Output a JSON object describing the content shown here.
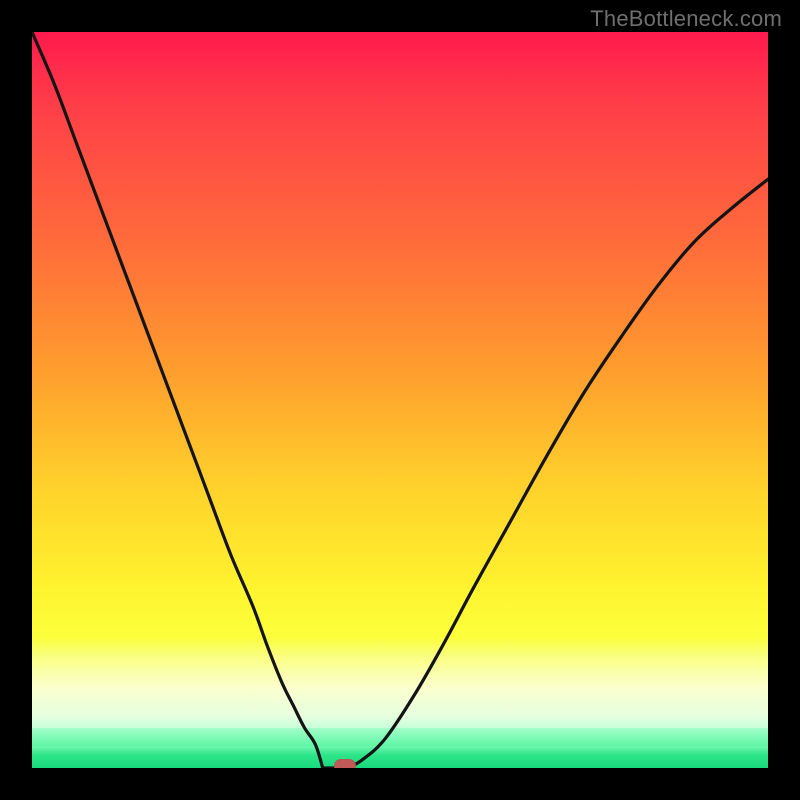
{
  "attribution": "TheBottleneck.com",
  "chart_data": {
    "type": "line",
    "title": "",
    "xlabel": "",
    "ylabel": "",
    "xlim": [
      0,
      1
    ],
    "ylim": [
      0,
      1
    ],
    "x": [
      0.0,
      0.03,
      0.06,
      0.09,
      0.12,
      0.15,
      0.18,
      0.21,
      0.24,
      0.27,
      0.3,
      0.32,
      0.34,
      0.355,
      0.37,
      0.385,
      0.4,
      0.41,
      0.417,
      0.423,
      0.43,
      0.45,
      0.48,
      0.52,
      0.56,
      0.6,
      0.65,
      0.7,
      0.75,
      0.8,
      0.85,
      0.9,
      0.95,
      1.0
    ],
    "y": [
      1.0,
      0.93,
      0.85,
      0.77,
      0.69,
      0.61,
      0.53,
      0.45,
      0.37,
      0.29,
      0.22,
      0.165,
      0.115,
      0.085,
      0.055,
      0.032,
      0.015,
      0.005,
      0.0,
      0.0,
      0.0,
      0.012,
      0.04,
      0.1,
      0.17,
      0.245,
      0.335,
      0.425,
      0.51,
      0.585,
      0.655,
      0.715,
      0.76,
      0.8
    ],
    "valley_flat": {
      "x_start": 0.395,
      "x_end": 0.43,
      "y": 0.0
    },
    "marker": {
      "x": 0.425,
      "y": 0.0,
      "color": "#c05a58"
    },
    "background": {
      "gradient_stops": [
        {
          "pos": 0.0,
          "color": "#ff1a4d"
        },
        {
          "pos": 0.45,
          "color": "#ff9a2e"
        },
        {
          "pos": 0.75,
          "color": "#fff22e"
        },
        {
          "pos": 0.94,
          "color": "#b4ffcf"
        },
        {
          "pos": 1.0,
          "color": "#18e080"
        }
      ],
      "green_strip_fraction": 0.03
    }
  },
  "style": {
    "curve_stroke": "#141414",
    "curve_width": 3.2,
    "frame_border_px": 32
  }
}
